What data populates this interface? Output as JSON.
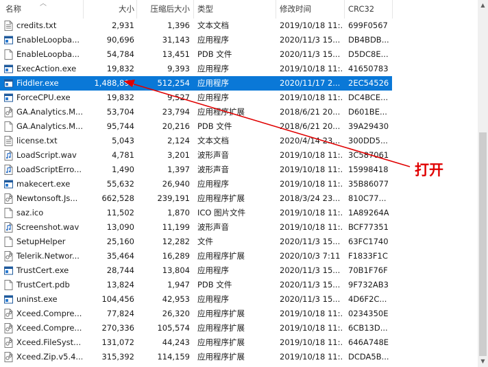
{
  "columns": {
    "name": "名称",
    "size": "大小",
    "compressed": "压缩后大小",
    "type": "类型",
    "modified": "修改时间",
    "crc": "CRC32"
  },
  "annotation": {
    "text": "打开",
    "color": "#e00000"
  },
  "accent": "#0a78d7",
  "files": [
    {
      "icon": "text-file-icon",
      "name": "credits.txt",
      "size": "2,931",
      "compressed": "1,396",
      "type": "文本文档",
      "modified": "2019/10/18 11:...",
      "crc": "699F0567"
    },
    {
      "icon": "app-icon",
      "name": "EnableLoopba...",
      "size": "90,696",
      "compressed": "31,143",
      "type": "应用程序",
      "modified": "2020/11/3 15...",
      "crc": "DB4BDB..."
    },
    {
      "icon": "blank-file-icon",
      "name": "EnableLoopba...",
      "size": "54,784",
      "compressed": "13,451",
      "type": "PDB 文件",
      "modified": "2020/11/3 15...",
      "crc": "D5DC8E..."
    },
    {
      "icon": "app-icon",
      "name": "ExecAction.exe",
      "size": "19,832",
      "compressed": "9,393",
      "type": "应用程序",
      "modified": "2019/10/18 11:...",
      "crc": "41650783"
    },
    {
      "icon": "app-icon",
      "name": "Fiddler.exe",
      "size": "1,488,896",
      "compressed": "512,254",
      "type": "应用程序",
      "modified": "2020/11/17 2...",
      "crc": "2EC54526",
      "selected": true
    },
    {
      "icon": "app-icon",
      "name": "ForceCPU.exe",
      "size": "19,832",
      "compressed": "9,527",
      "type": "应用程序",
      "modified": "2019/10/18 11:...",
      "crc": "DC4BCE..."
    },
    {
      "icon": "dll-icon",
      "name": "GA.Analytics.M...",
      "size": "53,704",
      "compressed": "23,794",
      "type": "应用程序扩展",
      "modified": "2018/6/21 20...",
      "crc": "D601BE..."
    },
    {
      "icon": "blank-file-icon",
      "name": "GA.Analytics.M...",
      "size": "95,744",
      "compressed": "20,216",
      "type": "PDB 文件",
      "modified": "2018/6/21 20...",
      "crc": "39A29430"
    },
    {
      "icon": "text-file-icon",
      "name": "license.txt",
      "size": "5,043",
      "compressed": "2,124",
      "type": "文本文档",
      "modified": "2020/4/14 23...",
      "crc": "300DD5..."
    },
    {
      "icon": "audio-file-icon",
      "name": "LoadScript.wav",
      "size": "4,781",
      "compressed": "3,201",
      "type": "波形声音",
      "modified": "2019/10/18 11:...",
      "crc": "3C587061"
    },
    {
      "icon": "audio-file-icon",
      "name": "LoadScriptErro...",
      "size": "1,490",
      "compressed": "1,397",
      "type": "波形声音",
      "modified": "2019/10/18 11:...",
      "crc": "15998418"
    },
    {
      "icon": "app-icon",
      "name": "makecert.exe",
      "size": "55,632",
      "compressed": "26,940",
      "type": "应用程序",
      "modified": "2019/10/18 11:...",
      "crc": "35B86077"
    },
    {
      "icon": "dll-icon",
      "name": "Newtonsoft.Js...",
      "size": "662,528",
      "compressed": "239,191",
      "type": "应用程序扩展",
      "modified": "2018/3/24 23...",
      "crc": "810C77..."
    },
    {
      "icon": "blank-file-icon",
      "name": "saz.ico",
      "size": "11,502",
      "compressed": "1,870",
      "type": "ICO 图片文件",
      "modified": "2019/10/18 11:...",
      "crc": "1A89264A"
    },
    {
      "icon": "audio-file-icon",
      "name": "Screenshot.wav",
      "size": "13,090",
      "compressed": "11,199",
      "type": "波形声音",
      "modified": "2019/10/18 11:...",
      "crc": "BCF77351"
    },
    {
      "icon": "blank-file-icon",
      "name": "SetupHelper",
      "size": "25,160",
      "compressed": "12,282",
      "type": "文件",
      "modified": "2020/11/3 15...",
      "crc": "63FC1740"
    },
    {
      "icon": "dll-icon",
      "name": "Telerik.Networ...",
      "size": "35,464",
      "compressed": "16,289",
      "type": "应用程序扩展",
      "modified": "2020/10/3 7:11",
      "crc": "F1833F1C"
    },
    {
      "icon": "app-icon",
      "name": "TrustCert.exe",
      "size": "28,744",
      "compressed": "13,804",
      "type": "应用程序",
      "modified": "2020/11/3 15...",
      "crc": "70B1F76F"
    },
    {
      "icon": "blank-file-icon",
      "name": "TrustCert.pdb",
      "size": "13,824",
      "compressed": "1,947",
      "type": "PDB 文件",
      "modified": "2020/11/3 15...",
      "crc": "9F732AB3"
    },
    {
      "icon": "app-icon",
      "name": "uninst.exe",
      "size": "104,456",
      "compressed": "42,953",
      "type": "应用程序",
      "modified": "2020/11/3 15...",
      "crc": "4D6F2C..."
    },
    {
      "icon": "dll-icon",
      "name": "Xceed.Compre...",
      "size": "77,824",
      "compressed": "26,320",
      "type": "应用程序扩展",
      "modified": "2019/10/18 11:...",
      "crc": "0234350E"
    },
    {
      "icon": "dll-icon",
      "name": "Xceed.Compre...",
      "size": "270,336",
      "compressed": "105,574",
      "type": "应用程序扩展",
      "modified": "2019/10/18 11:...",
      "crc": "6CB13D..."
    },
    {
      "icon": "dll-icon",
      "name": "Xceed.FileSyst...",
      "size": "131,072",
      "compressed": "44,243",
      "type": "应用程序扩展",
      "modified": "2019/10/18 11:...",
      "crc": "646A748E"
    },
    {
      "icon": "dll-icon",
      "name": "Xceed.Zip.v5.4...",
      "size": "315,392",
      "compressed": "114,159",
      "type": "应用程序扩展",
      "modified": "2019/10/18 11:...",
      "crc": "DCDA5B..."
    }
  ]
}
